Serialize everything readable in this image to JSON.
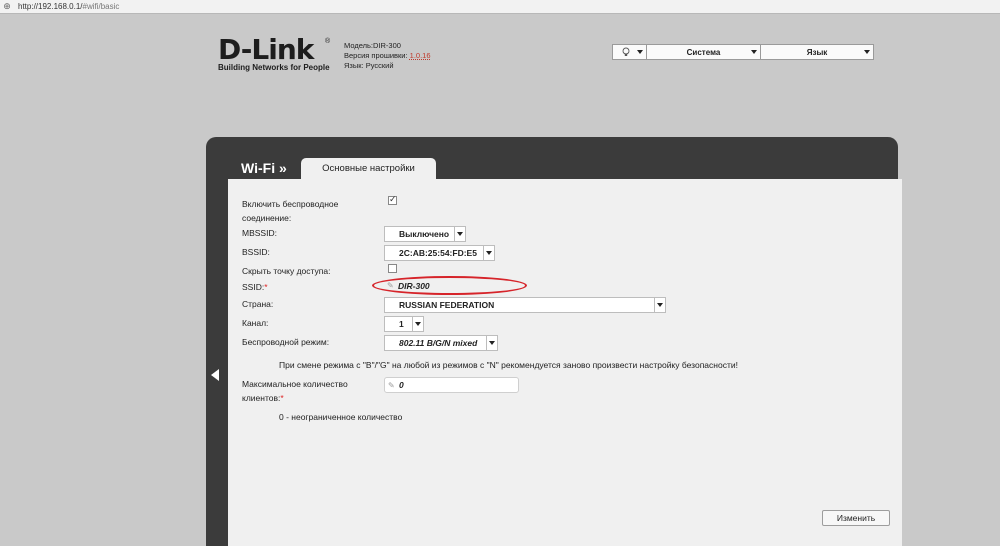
{
  "browser": {
    "url_host": "http://192.168.0.1/",
    "url_path": "#wifi/basic"
  },
  "header": {
    "logo_text": "D-Link",
    "logo_tagline": "Building Networks for People",
    "model_label": "Модель:",
    "model_value": "DIR-300",
    "firmware_label": "Версия прошивки: ",
    "firmware_value": "1.0.16",
    "language_info": "Язык: Русский"
  },
  "topmenu": {
    "icon": "lightbulb-icon",
    "system_label": "Система",
    "language_label": "Язык"
  },
  "section": {
    "title": "Wi-Fi »",
    "tab_label": "Основные настройки"
  },
  "form": {
    "enable_wireless_label_1": "Включить беспроводное",
    "enable_wireless_label_2": "соединение:",
    "enable_wireless_checked": true,
    "mbssid_label": "MBSSID:",
    "mbssid_value": "Выключено",
    "bssid_label": "BSSID:",
    "bssid_value": "2C:AB:25:54:FD:E5",
    "hide_ap_label": "Скрыть точку доступа:",
    "hide_ap_checked": false,
    "ssid_label": "SSID:",
    "ssid_required": "*",
    "ssid_value": "DIR-300",
    "country_label": "Страна:",
    "country_value": "RUSSIAN FEDERATION",
    "channel_label": "Канал:",
    "channel_value": "1",
    "mode_label": "Беспроводной режим:",
    "mode_value": "802.11 B/G/N mixed",
    "mode_note": "При смене режима с \"B\"/\"G\" на любой из режимов с \"N\" рекомендуется заново произвести настройку безопасности!",
    "max_clients_label_1": "Максимальное количество",
    "max_clients_label_2": "клиентов:",
    "max_clients_required": "*",
    "max_clients_value": "0",
    "max_clients_note": "0 - неограниченное количество"
  },
  "actions": {
    "apply_label": "Изменить"
  },
  "colors": {
    "panel": "#3b3b3b",
    "content": "#f0f0f0",
    "highlight_oval": "#d6242a",
    "firmware_link": "#c0392b"
  }
}
